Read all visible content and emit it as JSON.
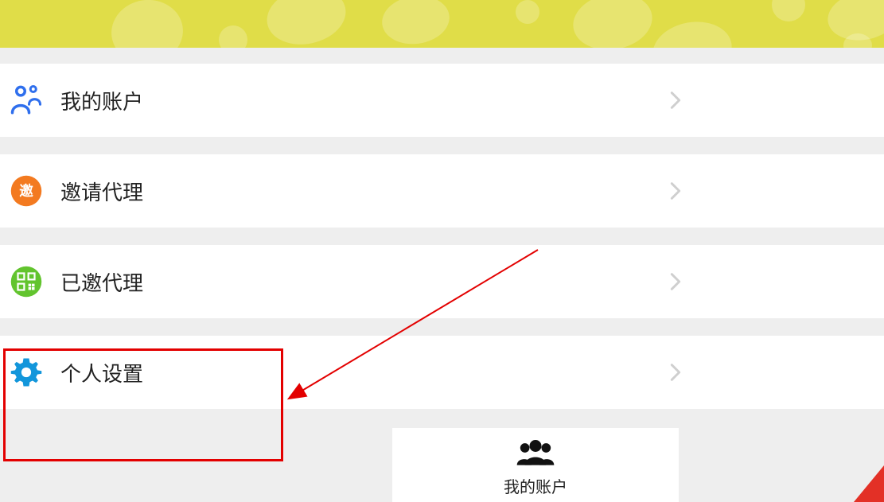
{
  "menu": {
    "items": [
      {
        "label": "我的账户",
        "icon": "people-icon",
        "color": "#2f6fed"
      },
      {
        "label": "邀请代理",
        "icon": "invite-icon",
        "color": "#f37a20"
      },
      {
        "label": "已邀代理",
        "icon": "qrcode-icon",
        "color": "#62c42e"
      },
      {
        "label": "个人设置",
        "icon": "gear-icon",
        "color": "#1296db"
      }
    ]
  },
  "bottom": {
    "label": "我的账户"
  }
}
